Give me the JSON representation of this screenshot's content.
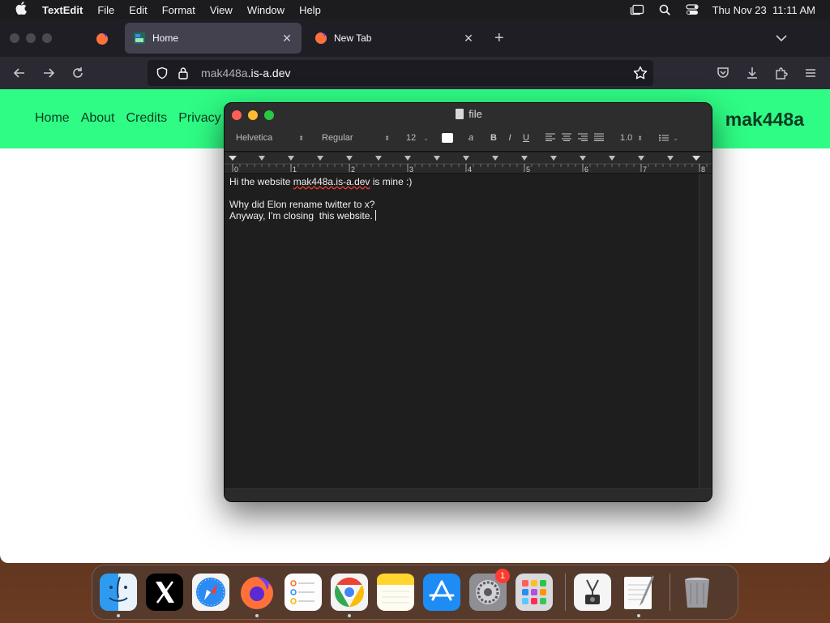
{
  "menubar": {
    "app_name": "TextEdit",
    "items": [
      "File",
      "Edit",
      "Format",
      "View",
      "Window",
      "Help"
    ],
    "clock": "Thu Nov 23  11:11 AM"
  },
  "browser": {
    "tabs": [
      {
        "title": "Home",
        "active": true
      },
      {
        "title": "New Tab",
        "active": false
      }
    ],
    "url": {
      "host_main": "mak448a",
      "host_rest": ".is-a.dev"
    }
  },
  "website": {
    "nav": [
      "Home",
      "About",
      "Credits",
      "Privacy"
    ],
    "brand": "mak448a",
    "header_color": "#2efc84"
  },
  "textedit": {
    "title": "file",
    "toolbar": {
      "font_family": "Helvetica",
      "font_style": "Regular",
      "font_size": "12",
      "bold": "B",
      "italic": "I",
      "underline": "U",
      "line_spacing": "1.0"
    },
    "ruler_numbers": [
      "0",
      "1",
      "2",
      "3",
      "4",
      "5",
      "6",
      "7",
      "8"
    ],
    "lines": [
      {
        "before": "Hi the website ",
        "error": "mak448a.is-a.dev",
        "after": " is mine :)"
      },
      {
        "text": ""
      },
      {
        "text": "Why did Elon rename twitter to x?"
      },
      {
        "text": "Anyway, I'm closing  this website."
      }
    ]
  },
  "dock": {
    "items": [
      {
        "name": "Finder",
        "icon": "finder-icon",
        "running": true
      },
      {
        "name": "X",
        "icon": "x-icon",
        "running": false
      },
      {
        "name": "Safari",
        "icon": "safari-icon",
        "running": false
      },
      {
        "name": "Firefox",
        "icon": "firefox-icon",
        "running": true
      },
      {
        "name": "Reminders",
        "icon": "reminders-icon",
        "running": false
      },
      {
        "name": "Chrome",
        "icon": "chrome-icon",
        "running": true
      },
      {
        "name": "Notes",
        "icon": "notes-icon",
        "running": false
      },
      {
        "name": "App Store",
        "icon": "appstore-icon",
        "running": false
      },
      {
        "name": "System Settings",
        "icon": "settings-icon",
        "running": false,
        "badge": "1"
      },
      {
        "name": "Launchpad",
        "icon": "launchpad-icon",
        "running": false
      },
      {
        "name": "Screenshot",
        "icon": "screenshot-icon",
        "running": false
      },
      {
        "name": "TextEdit",
        "icon": "textedit-icon",
        "running": true
      },
      {
        "name": "Trash",
        "icon": "trash-icon",
        "running": false
      }
    ]
  }
}
